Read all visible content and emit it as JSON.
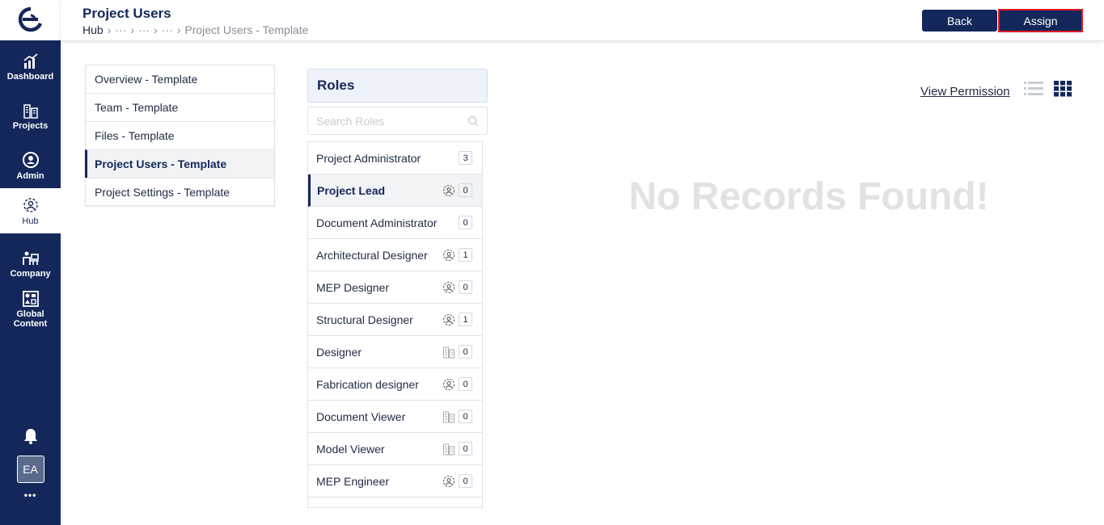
{
  "nav": {
    "items": [
      {
        "label": "Dashboard"
      },
      {
        "label": "Projects"
      },
      {
        "label": "Admin"
      },
      {
        "label": "Hub"
      },
      {
        "label": "Company"
      },
      {
        "label": "Global Content"
      }
    ],
    "avatar_initials": "EA",
    "more": "•••"
  },
  "header": {
    "title": "Project Users",
    "breadcrumb": [
      "Hub",
      "›",
      "···",
      "›",
      "···",
      "›",
      "···",
      "›",
      "Project Users - Template"
    ],
    "back_label": "Back",
    "assign_label": "Assign"
  },
  "menu": {
    "items": [
      {
        "label": "Overview - Template"
      },
      {
        "label": "Team - Template"
      },
      {
        "label": "Files - Template"
      },
      {
        "label": "Project Users - Template"
      },
      {
        "label": "Project Settings - Template"
      }
    ]
  },
  "roles": {
    "title": "Roles",
    "search_placeholder": "Search Roles",
    "items": [
      {
        "name": "Project Administrator",
        "count": "3",
        "icon": "none"
      },
      {
        "name": "Project Lead",
        "count": "0",
        "icon": "hub-icon"
      },
      {
        "name": "Document Administrator",
        "count": "0",
        "icon": "none"
      },
      {
        "name": "Architectural Designer",
        "count": "1",
        "icon": "hub-icon"
      },
      {
        "name": "MEP Designer",
        "count": "0",
        "icon": "hub-icon"
      },
      {
        "name": "Structural Designer",
        "count": "1",
        "icon": "hub-icon"
      },
      {
        "name": "Designer",
        "count": "0",
        "icon": "building-icon"
      },
      {
        "name": "Fabrication designer",
        "count": "0",
        "icon": "hub-icon"
      },
      {
        "name": "Document Viewer",
        "count": "0",
        "icon": "building-icon"
      },
      {
        "name": "Model Viewer",
        "count": "0",
        "icon": "building-icon"
      },
      {
        "name": "MEP Engineer",
        "count": "0",
        "icon": "hub-icon"
      }
    ]
  },
  "content": {
    "view_permission": "View Permission",
    "empty_message": "No Records Found!"
  },
  "colors": {
    "brand": "#13275a",
    "highlight": "#e01b24"
  }
}
